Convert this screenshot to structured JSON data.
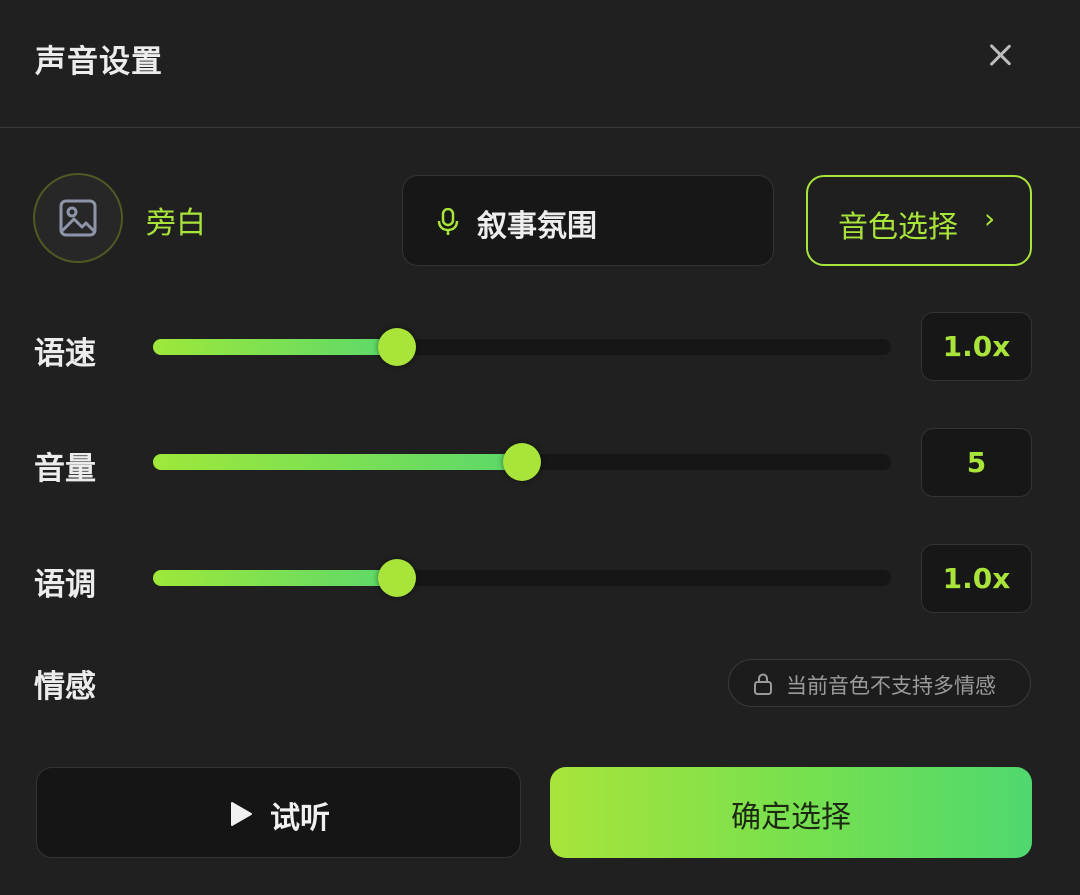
{
  "header": {
    "title": "声音设置"
  },
  "voice": {
    "name": "旁白",
    "style": "叙事氛围",
    "timbre_button": "音色选择",
    "chevron": "›"
  },
  "sliders": [
    {
      "label": "语速",
      "value_text": "1.0x",
      "fraction": 0.33
    },
    {
      "label": "音量",
      "value_text": "5",
      "fraction": 0.5
    },
    {
      "label": "语调",
      "value_text": "1.0x",
      "fraction": 0.33
    }
  ],
  "emotion": {
    "label": "情感",
    "notice": "当前音色不支持多情感"
  },
  "actions": {
    "preview_label": "试听",
    "confirm_label": "确定选择"
  },
  "colors": {
    "accent": "#a8e43a",
    "accent_end": "#4fd86f",
    "background": "#202020"
  },
  "icons": {
    "close": "close-icon",
    "avatar": "image-icon",
    "mic": "mic-icon",
    "lock": "lock-icon",
    "play": "play-icon"
  }
}
